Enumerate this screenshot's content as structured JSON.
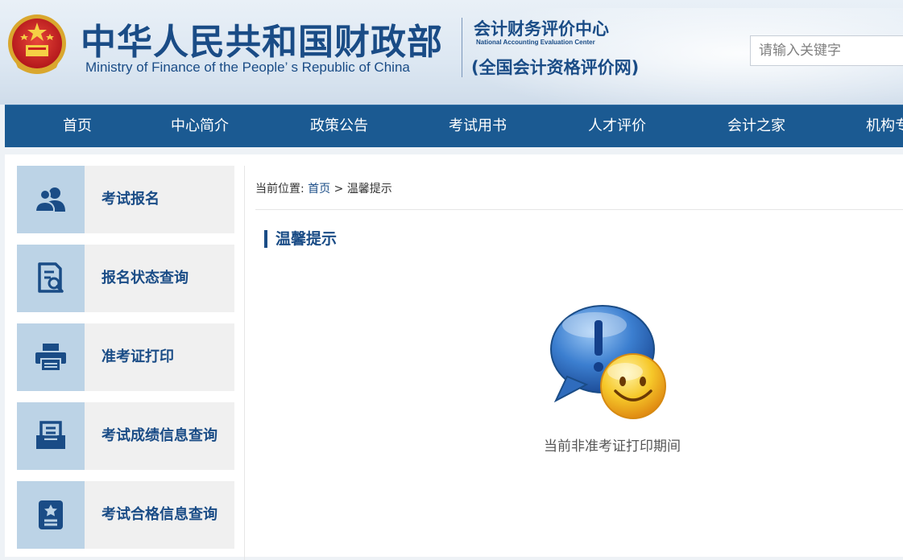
{
  "header": {
    "title_cn": "中华人民共和国财政部",
    "title_en": "Ministry of Finance of the People’ s Republic of China",
    "center_cn": "会计财务评价中心",
    "center_en": "National Accounting Evaluation Center",
    "center_sub": "(全国会计资格评价网)",
    "search_placeholder": "请输入关键字"
  },
  "nav": {
    "items": [
      {
        "label": "首页"
      },
      {
        "label": "中心简介"
      },
      {
        "label": "政策公告"
      },
      {
        "label": "考试用书"
      },
      {
        "label": "人才评价"
      },
      {
        "label": "会计之家"
      },
      {
        "label": "机构专"
      }
    ]
  },
  "sidebar": {
    "items": [
      {
        "label": "考试报名",
        "icon": "users-icon"
      },
      {
        "label": "报名状态查询",
        "icon": "document-search-icon"
      },
      {
        "label": "准考证打印",
        "icon": "printer-icon"
      },
      {
        "label": "考试成绩信息查询",
        "icon": "inbox-icon"
      },
      {
        "label": "考试合格信息查询",
        "icon": "certificate-icon"
      }
    ]
  },
  "breadcrumb": {
    "prefix": "当前位置:",
    "home": "首页",
    "separator": ">",
    "current": "温馨提示"
  },
  "content": {
    "section_title": "温馨提示",
    "message": "当前非准考证打印期间"
  },
  "colors": {
    "nav_bg": "#1b5a92",
    "brand_blue": "#1a4c86",
    "icon_box": "#bcd3e6"
  }
}
